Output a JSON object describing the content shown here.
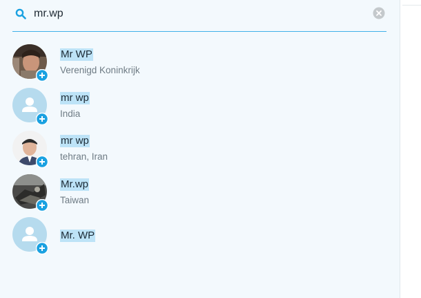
{
  "search": {
    "value": "mr.wp",
    "accent_color": "#3fb0e8"
  },
  "icons": {
    "search": "search-icon",
    "clear": "clear-icon",
    "add_contact": "add-contact-icon",
    "default_avatar": "default-person-icon"
  },
  "results": [
    {
      "name": "Mr WP",
      "location": "Verenigd Koninkrijk",
      "avatar": "photo"
    },
    {
      "name": "mr wp",
      "location": "India",
      "avatar": "default"
    },
    {
      "name": "mr wp",
      "location": "tehran, Iran",
      "avatar": "photo"
    },
    {
      "name": "Mr.wp",
      "location": "Taiwan",
      "avatar": "photo"
    },
    {
      "name": "Mr. WP",
      "location": "",
      "avatar": "default"
    }
  ],
  "colors": {
    "panel_bg": "#f3f9fd",
    "highlight": "#bde3f7",
    "badge": "#1aa1e1",
    "default_avatar_bg": "#b6dbee"
  }
}
